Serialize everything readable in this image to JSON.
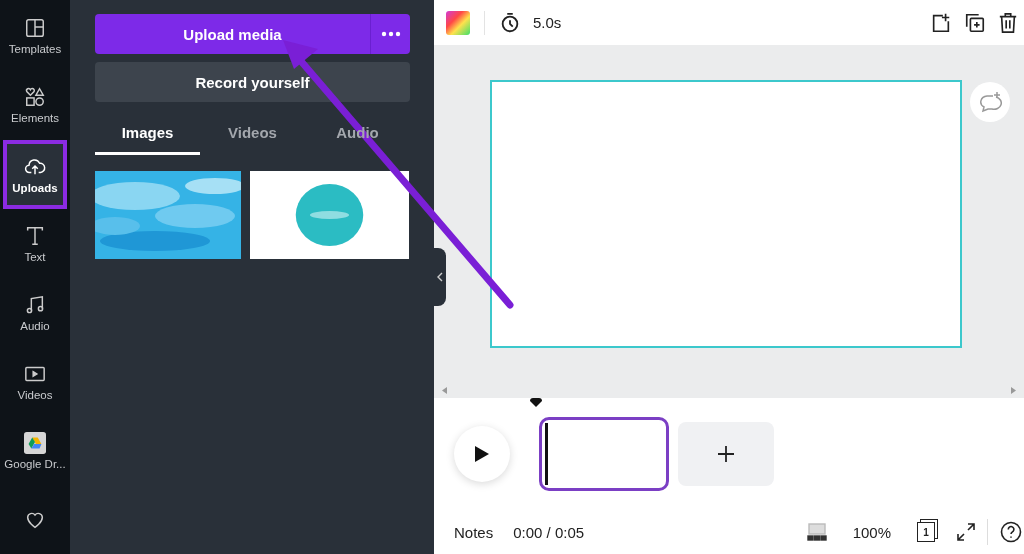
{
  "rail": {
    "items": [
      {
        "kind": "templates",
        "label": "Templates",
        "selected": false
      },
      {
        "kind": "elements",
        "label": "Elements",
        "selected": false
      },
      {
        "kind": "uploads",
        "label": "Uploads",
        "selected": true
      },
      {
        "kind": "text",
        "label": "Text",
        "selected": false
      },
      {
        "kind": "audio",
        "label": "Audio",
        "selected": false
      },
      {
        "kind": "videos",
        "label": "Videos",
        "selected": false
      },
      {
        "kind": "drive",
        "label": "Google Dr...",
        "selected": false
      },
      {
        "kind": "heart",
        "selected": false
      }
    ]
  },
  "panel": {
    "upload_button": "Upload media",
    "record_button": "Record yourself",
    "tabs": [
      {
        "label": "Images",
        "selected": true
      },
      {
        "label": "Videos",
        "selected": false
      },
      {
        "label": "Audio",
        "selected": false
      }
    ]
  },
  "toolbar": {
    "duration": "5.0s"
  },
  "timeline": {
    "pages": [
      {
        "selected": true
      }
    ]
  },
  "status_bar": {
    "notes": "Notes",
    "time": "0:00 / 0:05",
    "zoom": "100%",
    "page_count": "1"
  }
}
